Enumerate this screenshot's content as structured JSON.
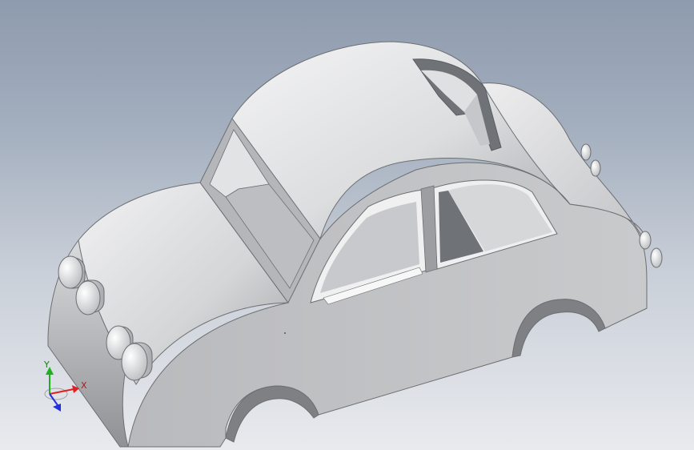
{
  "viewport": {
    "model_name": "car-body",
    "background_colors": [
      "#8e9bae",
      "#c9cfd8",
      "#e8eaee"
    ],
    "model_color": "#c8c9cb"
  },
  "triad": {
    "x_label": "X",
    "y_label": "Y",
    "x_color": "#e02020",
    "y_color": "#1fb01f",
    "z_color": "#2030e0"
  }
}
